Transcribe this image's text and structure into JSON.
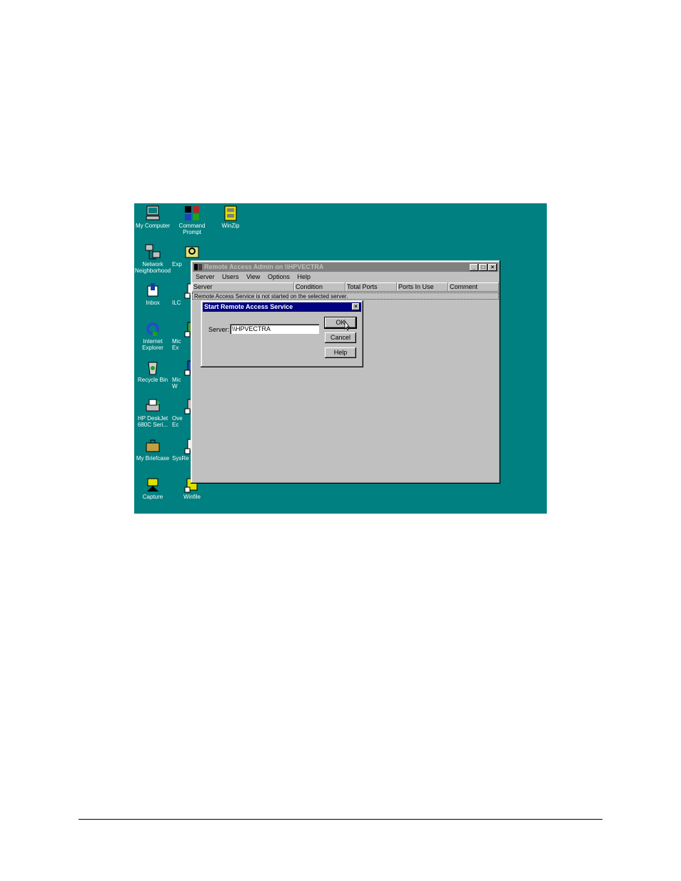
{
  "desktop": {
    "icons": [
      {
        "label": "My Computer",
        "icon": "computer-icon"
      },
      {
        "label": "Command\nPrompt",
        "icon": "ms-dos-icon"
      },
      {
        "label": "WinZip",
        "icon": "winzip-icon"
      },
      {
        "label": "Network\nNeighborhood",
        "icon": "network-icon"
      },
      {
        "label": "Exp",
        "icon": "explorer-icon"
      },
      {
        "label": "Inbox",
        "icon": "inbox-icon"
      },
      {
        "label": "ILC",
        "icon": "shortcut-icon"
      },
      {
        "label": "Internet\nExplorer",
        "icon": "ie-icon"
      },
      {
        "label": "Mic\nEx",
        "icon": "shortcut-icon"
      },
      {
        "label": "Recycle Bin",
        "icon": "recycle-bin-icon"
      },
      {
        "label": "Mic\nW",
        "icon": "shortcut-icon"
      },
      {
        "label": "HP DeskJet\n680C Seri...",
        "icon": "printer-icon"
      },
      {
        "label": "Ove\nEc",
        "icon": "shortcut-icon"
      },
      {
        "label": "My Briefcase",
        "icon": "briefcase-icon"
      },
      {
        "label": "SysRe",
        "icon": "shortcut-icon"
      },
      {
        "label": "Capture",
        "icon": "capture-icon"
      },
      {
        "label": "Winfile",
        "icon": "winfile-icon"
      }
    ]
  },
  "main_window": {
    "title": "Remote Access Admin on \\\\HPVECTRA",
    "menu": [
      "Server",
      "Users",
      "View",
      "Options",
      "Help"
    ],
    "columns": [
      "Server",
      "Condition",
      "Total Ports",
      "Ports In Use",
      "Comment"
    ],
    "status_row": "Remote Access Service is not started on the selected server."
  },
  "dialog": {
    "title": "Start Remote Access Service",
    "server_label": "Server:",
    "server_value": "\\\\HPVECTRA",
    "ok_label": "OK",
    "cancel_label": "Cancel",
    "help_label": "Help"
  },
  "colors": {
    "desktop": "#008080",
    "window_face": "#c0c0c0",
    "active_title": "#000080",
    "inactive_title": "#808080"
  }
}
